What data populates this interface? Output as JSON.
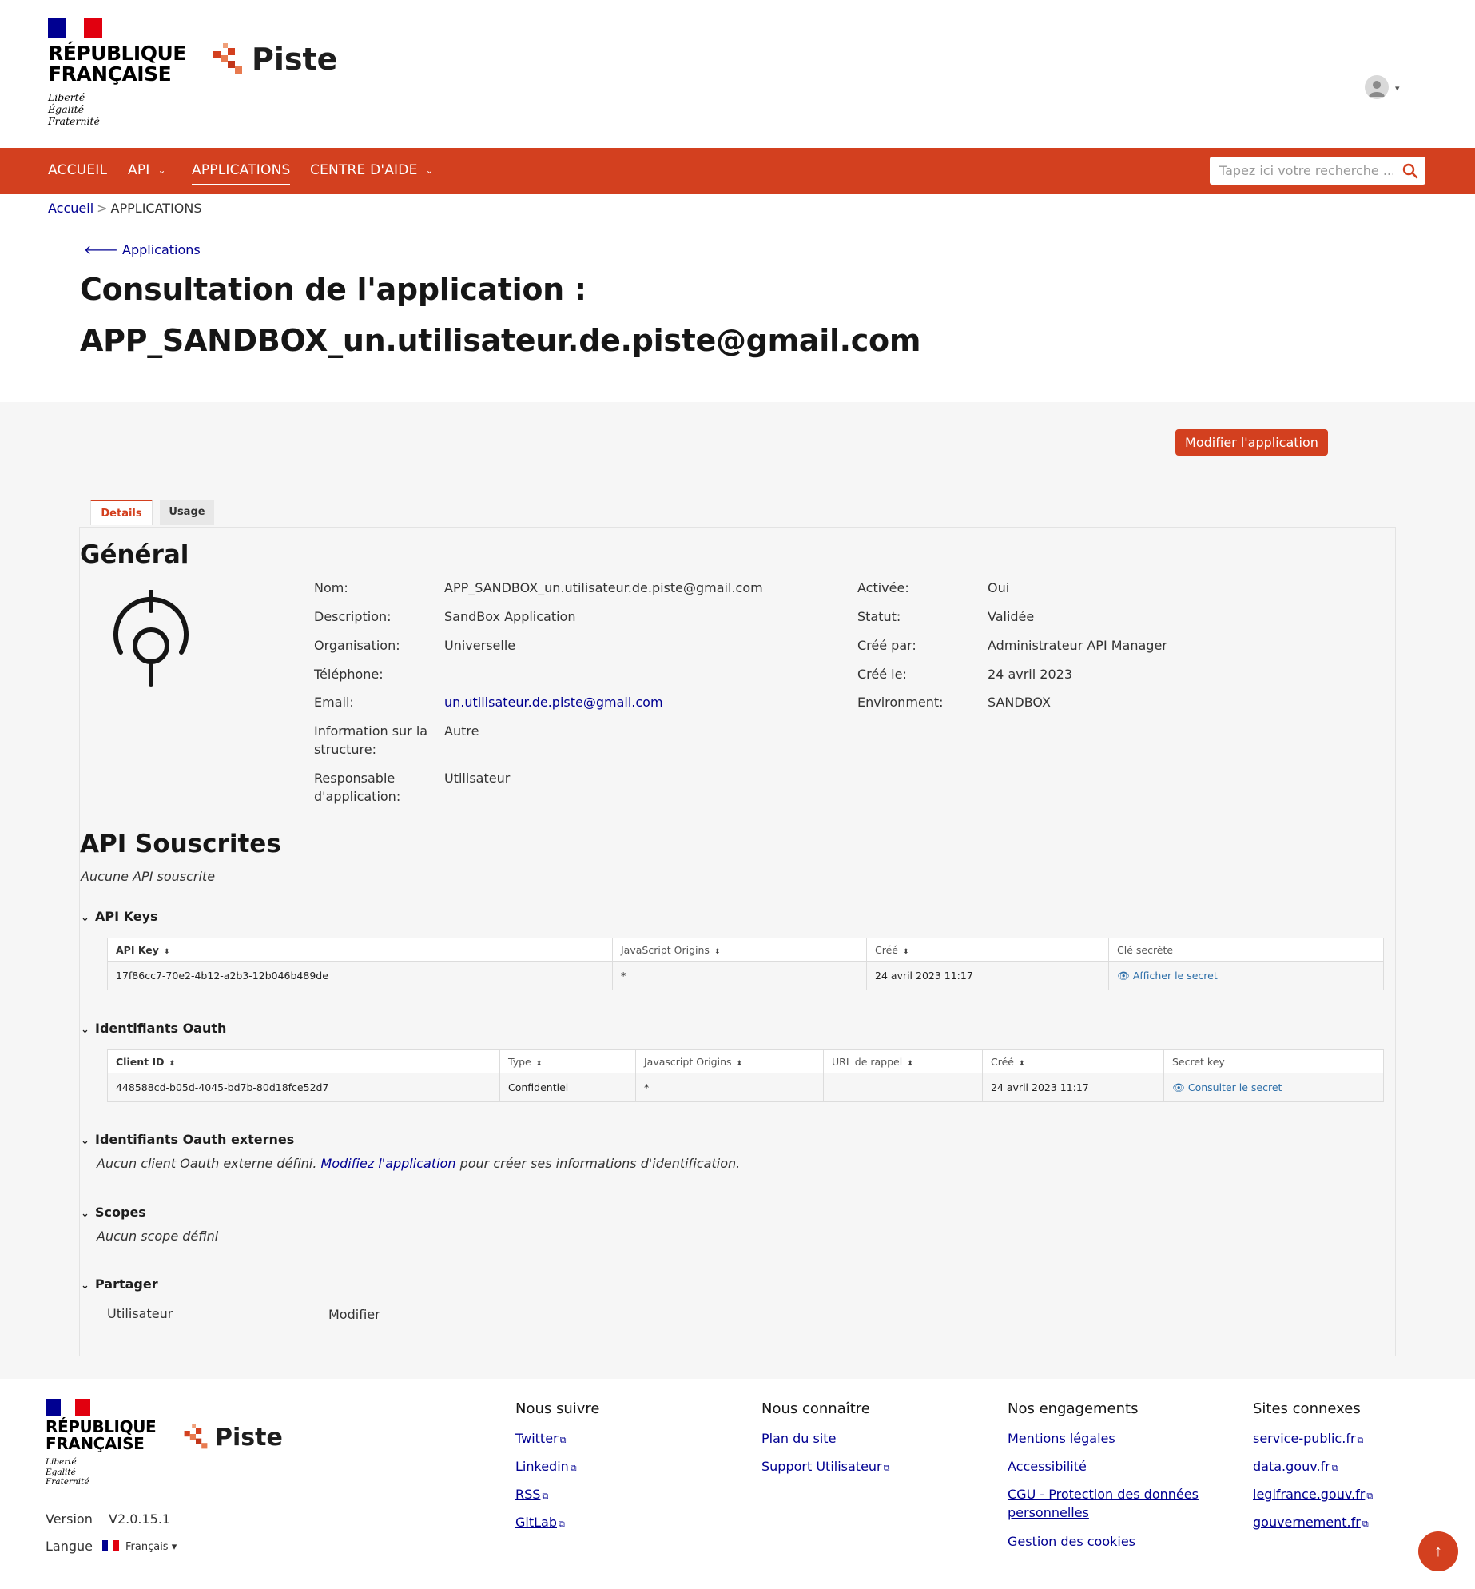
{
  "header": {
    "rf_name_line1": "RÉPUBLIQUE",
    "rf_name_line2": "FRANÇAISE",
    "rf_motto1": "Liberté",
    "rf_motto2": "Égalité",
    "rf_motto3": "Fraternité",
    "brand": "Piste"
  },
  "nav": {
    "items": [
      {
        "label": "ACCUEIL"
      },
      {
        "label": "API"
      },
      {
        "label": "APPLICATIONS"
      },
      {
        "label": "CENTRE D'AIDE"
      }
    ],
    "search_placeholder": "Tapez ici votre recherche ..."
  },
  "breadcrumb": {
    "home": "Accueil",
    "separator": ">",
    "current": "APPLICATIONS"
  },
  "page": {
    "back_label": "Applications",
    "title_line1": "Consultation de l'application :",
    "title_line2": "APP_SANDBOX_un.utilisateur.de.piste@gmail.com",
    "modify_button": "Modifier l'application",
    "tabs": [
      {
        "label": "Details"
      },
      {
        "label": "Usage"
      }
    ]
  },
  "general": {
    "title": "Général",
    "left_fields": [
      {
        "label": "Nom:",
        "value": "APP_SANDBOX_un.utilisateur.de.piste@gmail.com"
      },
      {
        "label": "Description:",
        "value": "SandBox Application"
      },
      {
        "label": "Organisation:",
        "value": "Universelle"
      },
      {
        "label": "Téléphone:",
        "value": ""
      },
      {
        "label": "Email:",
        "value": "un.utilisateur.de.piste@gmail.com"
      },
      {
        "label": "Information sur la structure:",
        "value": "Autre"
      },
      {
        "label": "Responsable d'application:",
        "value": "Utilisateur"
      }
    ],
    "right_fields": [
      {
        "label": "Activée:",
        "value": "Oui"
      },
      {
        "label": "Statut:",
        "value": "Validée"
      },
      {
        "label": "Créé par:",
        "value": "Administrateur API Manager"
      },
      {
        "label": "Créé le:",
        "value": "24 avril 2023"
      },
      {
        "label": "Environment:",
        "value": "SANDBOX"
      }
    ]
  },
  "api_subscribed": {
    "title": "API Souscrites",
    "empty_note": "Aucune API souscrite"
  },
  "api_keys": {
    "title": "API Keys",
    "columns": [
      "API Key",
      "JavaScript Origins",
      "Créé",
      "Clé secrète"
    ],
    "rows": [
      {
        "key": "17f86cc7-70e2-4b12-a2b3-12b046b489de",
        "origins": "*",
        "created": "24 avril 2023 11:17",
        "secret_action": "Afficher le secret"
      }
    ]
  },
  "oauth": {
    "title": "Identifiants Oauth",
    "columns": [
      "Client ID",
      "Type",
      "Javascript Origins",
      "URL de rappel",
      "Créé",
      "Secret key"
    ],
    "rows": [
      {
        "client_id": "448588cd-b05d-4045-bd7b-80d18fce52d7",
        "type": "Confidentiel",
        "origins": "*",
        "callback": "",
        "created": "24 avril 2023 11:17",
        "secret_action": "Consulter le secret"
      }
    ]
  },
  "oauth_external": {
    "title": "Identifiants Oauth externes",
    "note_before": "Aucun client Oauth externe défini.",
    "note_link": "Modifiez l'application",
    "note_after": "pour créer ses informations d'identification."
  },
  "scopes": {
    "title": "Scopes",
    "note": "Aucun scope défini"
  },
  "share": {
    "title": "Partager",
    "user": "Utilisateur",
    "action": "Modifier"
  },
  "footer": {
    "version_label": "Version",
    "version_value": "V2.0.15.1",
    "language_label": "Langue",
    "language_value": "Français",
    "columns": [
      {
        "title": "Nous suivre",
        "links": [
          "Twitter",
          "Linkedin",
          "RSS",
          "GitLab"
        ]
      },
      {
        "title": "Nous connaître",
        "links": [
          "Plan du site",
          "Support Utilisateur"
        ]
      },
      {
        "title": "Nos engagements",
        "links": [
          "Mentions légales",
          "Accessibilité",
          "CGU - Protection des données personnelles",
          "Gestion des cookies"
        ]
      },
      {
        "title": "Sites connexes",
        "links": [
          "service-public.fr",
          "data.gouv.fr",
          "legifrance.gouv.fr",
          "gouvernement.fr"
        ]
      }
    ]
  },
  "colors": {
    "accent": "#d3401f",
    "link": "#000091",
    "content_bg": "#f6f6f6"
  }
}
